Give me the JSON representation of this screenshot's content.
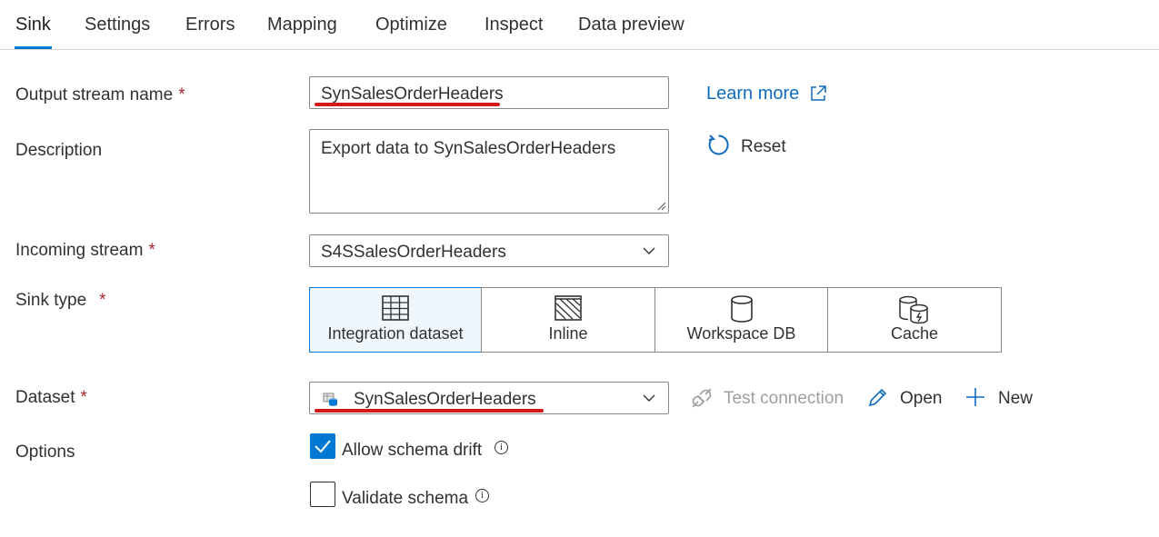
{
  "tabs": [
    "Sink",
    "Settings",
    "Errors",
    "Mapping",
    "Optimize",
    "Inspect",
    "Data preview"
  ],
  "active_tab": "Sink",
  "fields": {
    "output_stream_name": {
      "label": "Output stream name",
      "required": "*",
      "value": "SynSalesOrderHeaders"
    },
    "description": {
      "label": "Description",
      "value": "Export data to SynSalesOrderHeaders"
    },
    "incoming_stream": {
      "label": "Incoming stream",
      "required": "*",
      "value": "S4SSalesOrderHeaders"
    },
    "sink_type": {
      "label": "Sink type",
      "required": "*"
    },
    "dataset": {
      "label": "Dataset",
      "required": "*",
      "value": "SynSalesOrderHeaders"
    },
    "options": {
      "label": "Options"
    }
  },
  "links": {
    "learn_more": "Learn more",
    "reset": "Reset"
  },
  "sink_types": [
    {
      "label": "Integration dataset",
      "icon": "table-icon",
      "selected": true
    },
    {
      "label": "Inline",
      "icon": "hatched-box-icon",
      "selected": false
    },
    {
      "label": "Workspace DB",
      "icon": "database-icon",
      "selected": false
    },
    {
      "label": "Cache",
      "icon": "cache-icon",
      "selected": false
    }
  ],
  "dataset_actions": {
    "test_connection": "Test connection",
    "open": "Open",
    "new": "New"
  },
  "options": {
    "allow_schema_drift": {
      "label": "Allow schema drift",
      "checked": true
    },
    "validate_schema": {
      "label": "Validate schema",
      "checked": false
    }
  },
  "colors": {
    "accent": "#0078d4",
    "required": "#a4262c",
    "highlight_underline": "#d21a1a",
    "link": "#0f6cbd"
  }
}
